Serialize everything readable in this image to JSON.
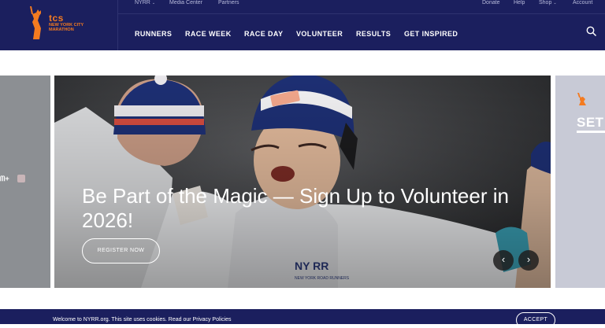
{
  "brand": {
    "logo_word": "tcs",
    "logo_line1": "NEW YORK CITY",
    "logo_line2": "MARATHON"
  },
  "topbar": {
    "left_items": [
      {
        "label": "NYRR",
        "has_caret": true
      },
      {
        "label": "Media Center",
        "has_caret": false
      },
      {
        "label": "Partners",
        "has_caret": false
      }
    ],
    "right_items": [
      {
        "label": "Donate",
        "has_caret": false
      },
      {
        "label": "Help",
        "has_caret": false
      },
      {
        "label": "Shop",
        "has_caret": true
      },
      {
        "label": "Account",
        "has_caret": false
      }
    ]
  },
  "main_nav": [
    "RUNNERS",
    "RACE WEEK",
    "RACE DAY",
    "VOLUNTEER",
    "RESULTS",
    "GET INSPIRED"
  ],
  "carousel": {
    "prev_fragment": "ᗰ+",
    "hero_title": "Be Part of the Magic — Sign Up to Volunteer in 2026!",
    "register_label": "REGISTER NOW",
    "prev_arrow": "‹",
    "next_arrow": "›",
    "next_slide_text": "SET"
  },
  "cookie": {
    "text": "Welcome to NYRR.org. This site uses cookies. Read our Privacy Policies",
    "accept_label": "ACCEPT"
  },
  "colors": {
    "navy": "#1b1f5e",
    "orange": "#f47b20"
  }
}
